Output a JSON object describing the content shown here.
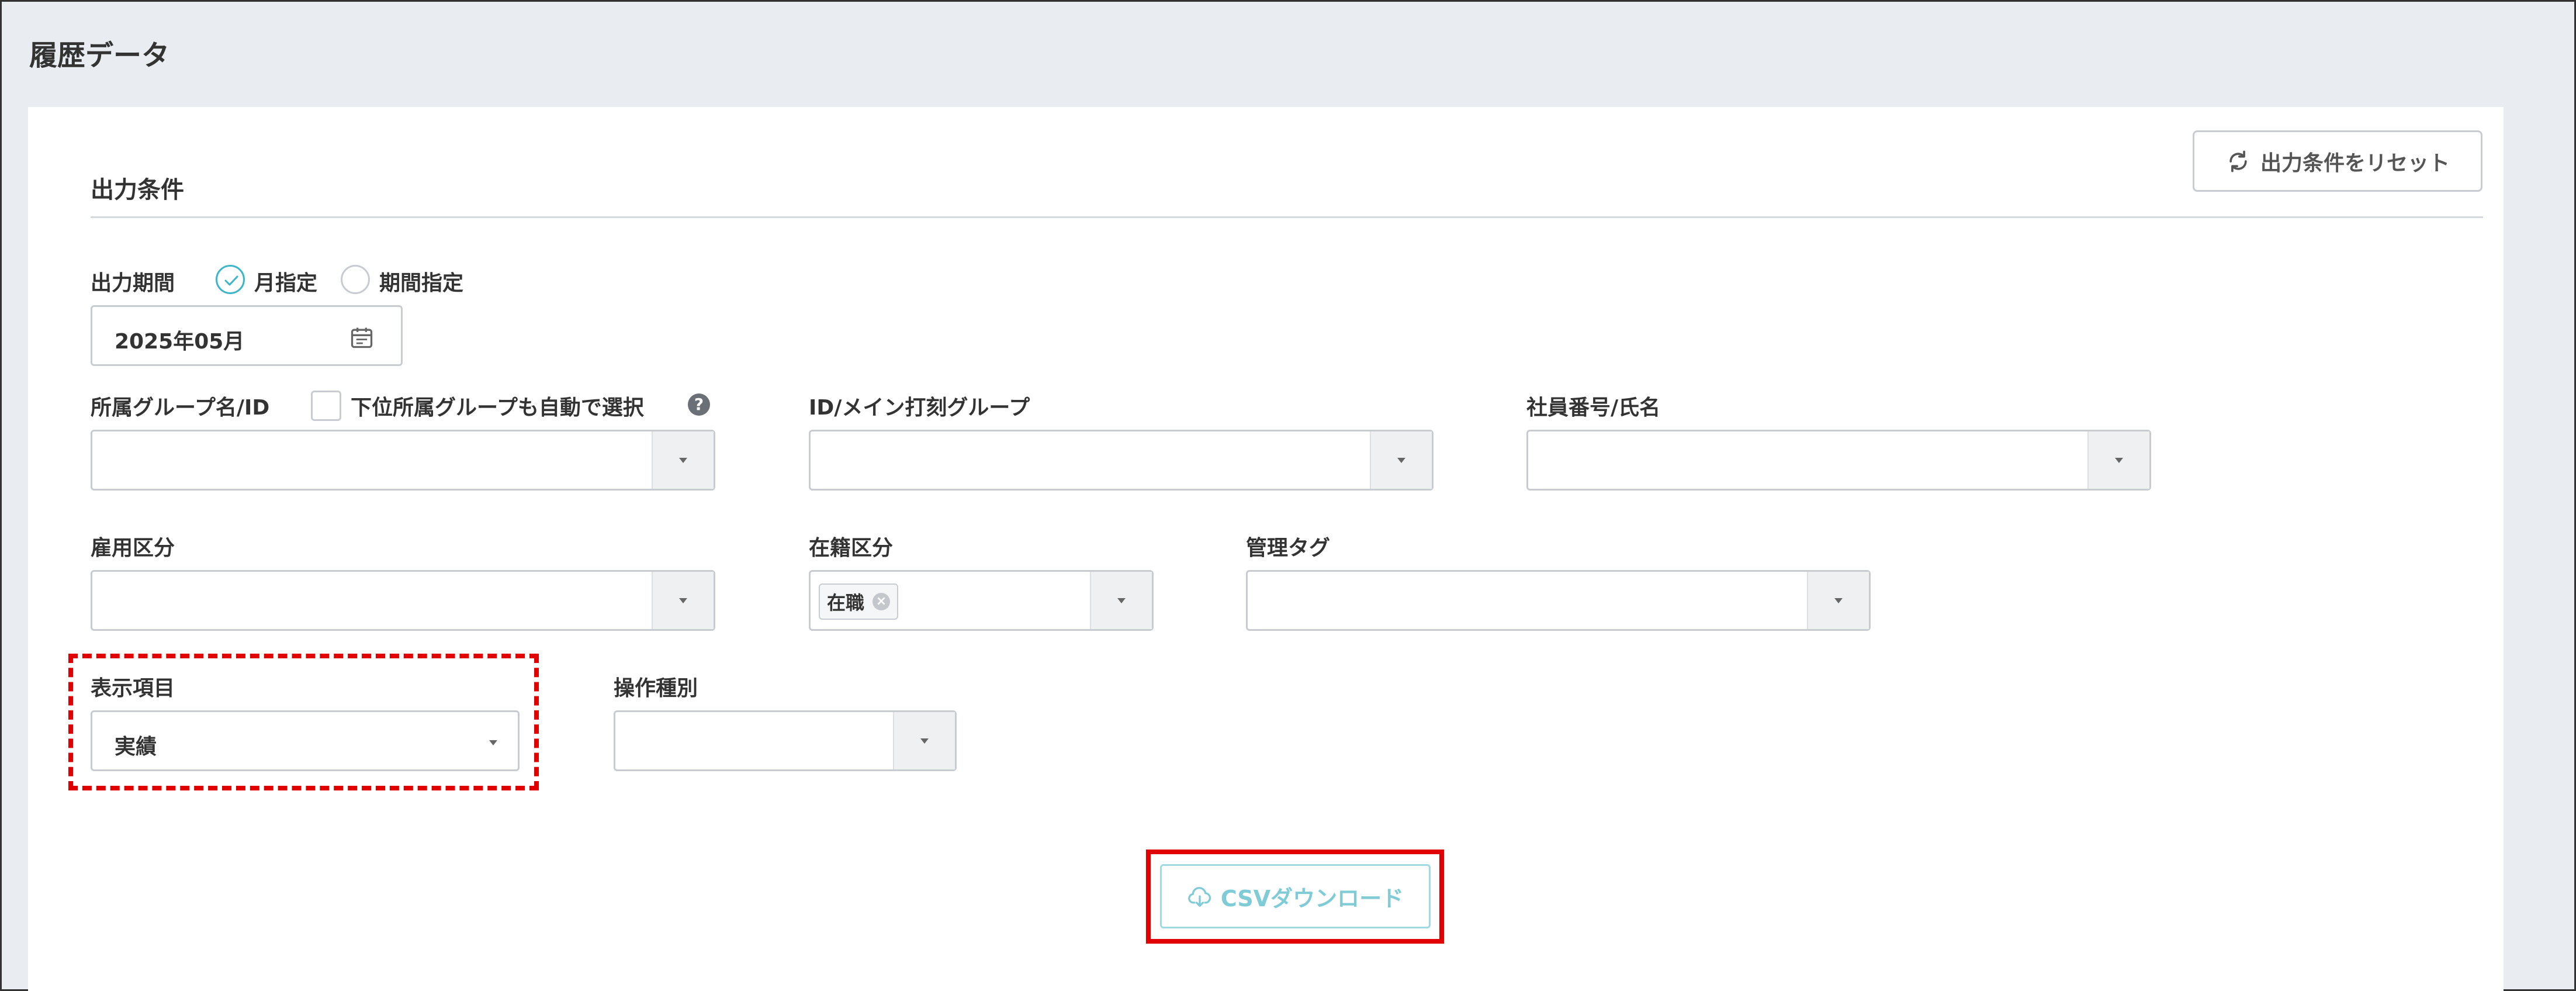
{
  "page": {
    "title": "履歴データ"
  },
  "section": {
    "title": "出力条件",
    "reset_label": "出力条件をリセット"
  },
  "period": {
    "label": "出力期間",
    "option_month": "月指定",
    "option_range": "期間指定",
    "selected": "月指定",
    "value": "2025年05月"
  },
  "group": {
    "label": "所属グループ名/ID",
    "checkbox_label": "下位所属グループも自動で選択",
    "help": "?",
    "value": ""
  },
  "main_group": {
    "label": "ID/メイン打刻グループ",
    "value": ""
  },
  "employee": {
    "label": "社員番号/氏名",
    "value": ""
  },
  "employment": {
    "label": "雇用区分",
    "value": ""
  },
  "enrollment": {
    "label": "在籍区分",
    "tag": "在職",
    "tag_remove": "×"
  },
  "mgmt_tag": {
    "label": "管理タグ",
    "value": ""
  },
  "display_item": {
    "label": "表示項目",
    "value": "実績"
  },
  "operation": {
    "label": "操作種別",
    "value": ""
  },
  "download": {
    "label": "CSVダウンロード"
  },
  "colors": {
    "accent": "#3bb6c8",
    "highlight": "#e00000"
  }
}
